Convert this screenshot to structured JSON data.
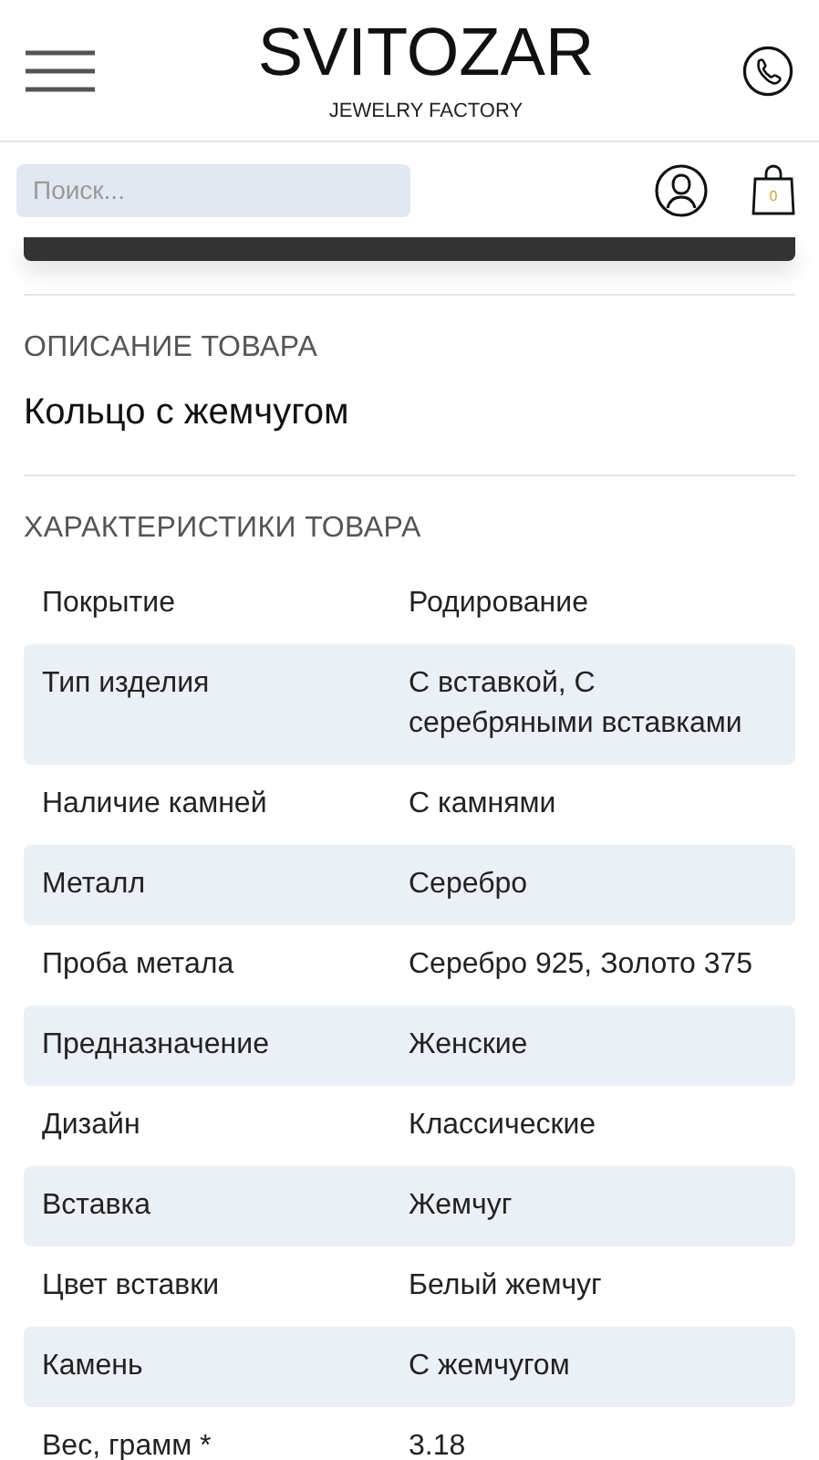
{
  "header": {
    "logo": "SVITOZAR",
    "tagline": "JEWELRY FACTORY"
  },
  "search": {
    "placeholder": "Поиск..."
  },
  "cart": {
    "count": "0"
  },
  "description": {
    "heading": "ОПИСАНИЕ ТОВАРА",
    "text": "Кольцо с жемчугом"
  },
  "specs": {
    "heading": "ХАРАКТЕРИСТИКИ ТОВАРА",
    "rows": [
      {
        "name": "Покрытие",
        "value": "Родирование"
      },
      {
        "name": "Тип изделия",
        "value": "С вставкой, С серебряными вставками"
      },
      {
        "name": "Наличие камней",
        "value": "С камнями"
      },
      {
        "name": "Металл",
        "value": "Серебро"
      },
      {
        "name": "Проба метала",
        "value": "Серебро 925, Золото 375"
      },
      {
        "name": "Предназначение",
        "value": "Женские"
      },
      {
        "name": "Дизайн",
        "value": "Классические"
      },
      {
        "name": "Вставка",
        "value": "Жемчуг"
      },
      {
        "name": "Цвет вставки",
        "value": "Белый жемчуг"
      },
      {
        "name": "Камень",
        "value": "С жемчугом"
      },
      {
        "name": "Вес, грамм *",
        "value": "3.18"
      }
    ]
  }
}
